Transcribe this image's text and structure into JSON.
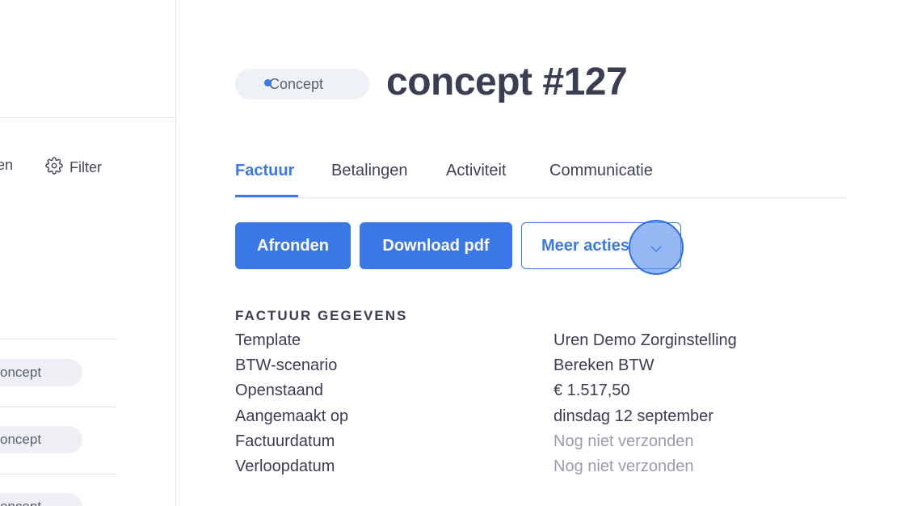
{
  "left_panel": {
    "sort_label_fragment": "en",
    "filter_label": "Filter",
    "items": [
      {
        "status": "oncept"
      },
      {
        "status": "oncept"
      },
      {
        "status": "oncept"
      }
    ]
  },
  "header": {
    "status": "Concept",
    "title": "concept #127"
  },
  "tabs": [
    {
      "label": "Factuur",
      "active": true
    },
    {
      "label": "Betalingen",
      "active": false
    },
    {
      "label": "Activiteit",
      "active": false
    },
    {
      "label": "Communicatie",
      "active": false
    }
  ],
  "actions": {
    "finalize_label": "Afronden",
    "download_label": "Download pdf",
    "more_label": "Meer acties"
  },
  "details": {
    "heading": "FACTUUR GEGEVENS",
    "rows": [
      {
        "label": "Template",
        "value": "Uren Demo Zorginstelling",
        "muted": false
      },
      {
        "label": "BTW-scenario",
        "value": "Bereken BTW",
        "muted": false
      },
      {
        "label": "Openstaand",
        "value": "€ 1.517,50",
        "muted": false
      },
      {
        "label": "Aangemaakt op",
        "value": "dinsdag 12 september",
        "muted": false
      },
      {
        "label": "Factuurdatum",
        "value": "Nog niet verzonden",
        "muted": true
      },
      {
        "label": "Verloopdatum",
        "value": "Nog niet verzonden",
        "muted": true
      }
    ]
  },
  "colors": {
    "accent": "#3b78e7",
    "text": "#3b3d52",
    "muted": "#9a9cab"
  }
}
